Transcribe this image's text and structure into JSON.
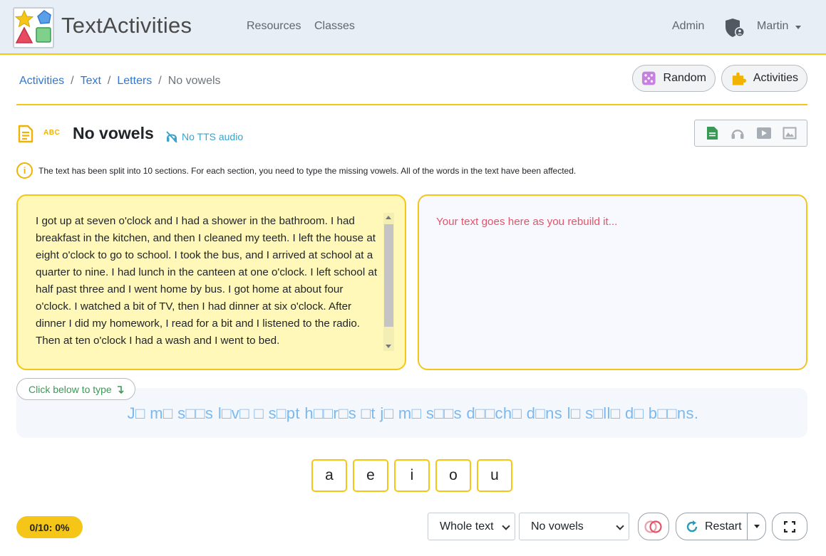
{
  "navbar": {
    "brand": "TextActivities",
    "links": [
      "Resources",
      "Classes"
    ],
    "admin": "Admin",
    "user": "Martin"
  },
  "breadcrumb": {
    "items": [
      "Activities",
      "Text",
      "Letters"
    ],
    "current": "No vowels"
  },
  "actions": {
    "random": "Random",
    "activities": "Activities"
  },
  "activity": {
    "badge": "ABC",
    "title": "No vowels",
    "tts": "No TTS audio",
    "modes": [
      "text-mode-icon",
      "audio-mode-icon",
      "video-mode-icon",
      "image-mode-icon"
    ]
  },
  "info": "The text has been split into 10 sections. For each section, you need to type the missing vowels. All of the words in the text have been affected.",
  "source_text": "I got up at seven o'clock and I had a shower in the bathroom. I had breakfast in the kitchen, and then I cleaned my teeth. I left the house at eight o'clock to go to school. I took the bus, and I arrived at school at a quarter to nine. I had lunch in the canteen at one o'clock. I left school at half past three and I went home by bus. I got home at about four o'clock. I watched a bit of TV, then I had dinner at six o'clock. After dinner I did my homework, I read for a bit and I listened to the radio. Then at ten o'clock I had a wash and I went to bed.",
  "target_placeholder": "Your text goes here as you rebuild it...",
  "click_below": "Click below to type",
  "puzzle": "J□ m□ s□□s l□v□ □ s□pt h□□r□s □t j□ m□ s□□s d□□ch□ d□ns l□ s□ll□ d□ b□□ns.",
  "vowels": [
    "a",
    "e",
    "i",
    "o",
    "u"
  ],
  "bottom": {
    "score": "0/10: 0%",
    "scope_select": "Whole text",
    "type_select": "No vowels",
    "restart": "Restart"
  },
  "colors": {
    "accent": "#f5c518",
    "link": "#2f77d1",
    "puzzle_text": "#7cb9ee",
    "placeholder": "#e0556a",
    "source_bg": "#fff8b8"
  }
}
